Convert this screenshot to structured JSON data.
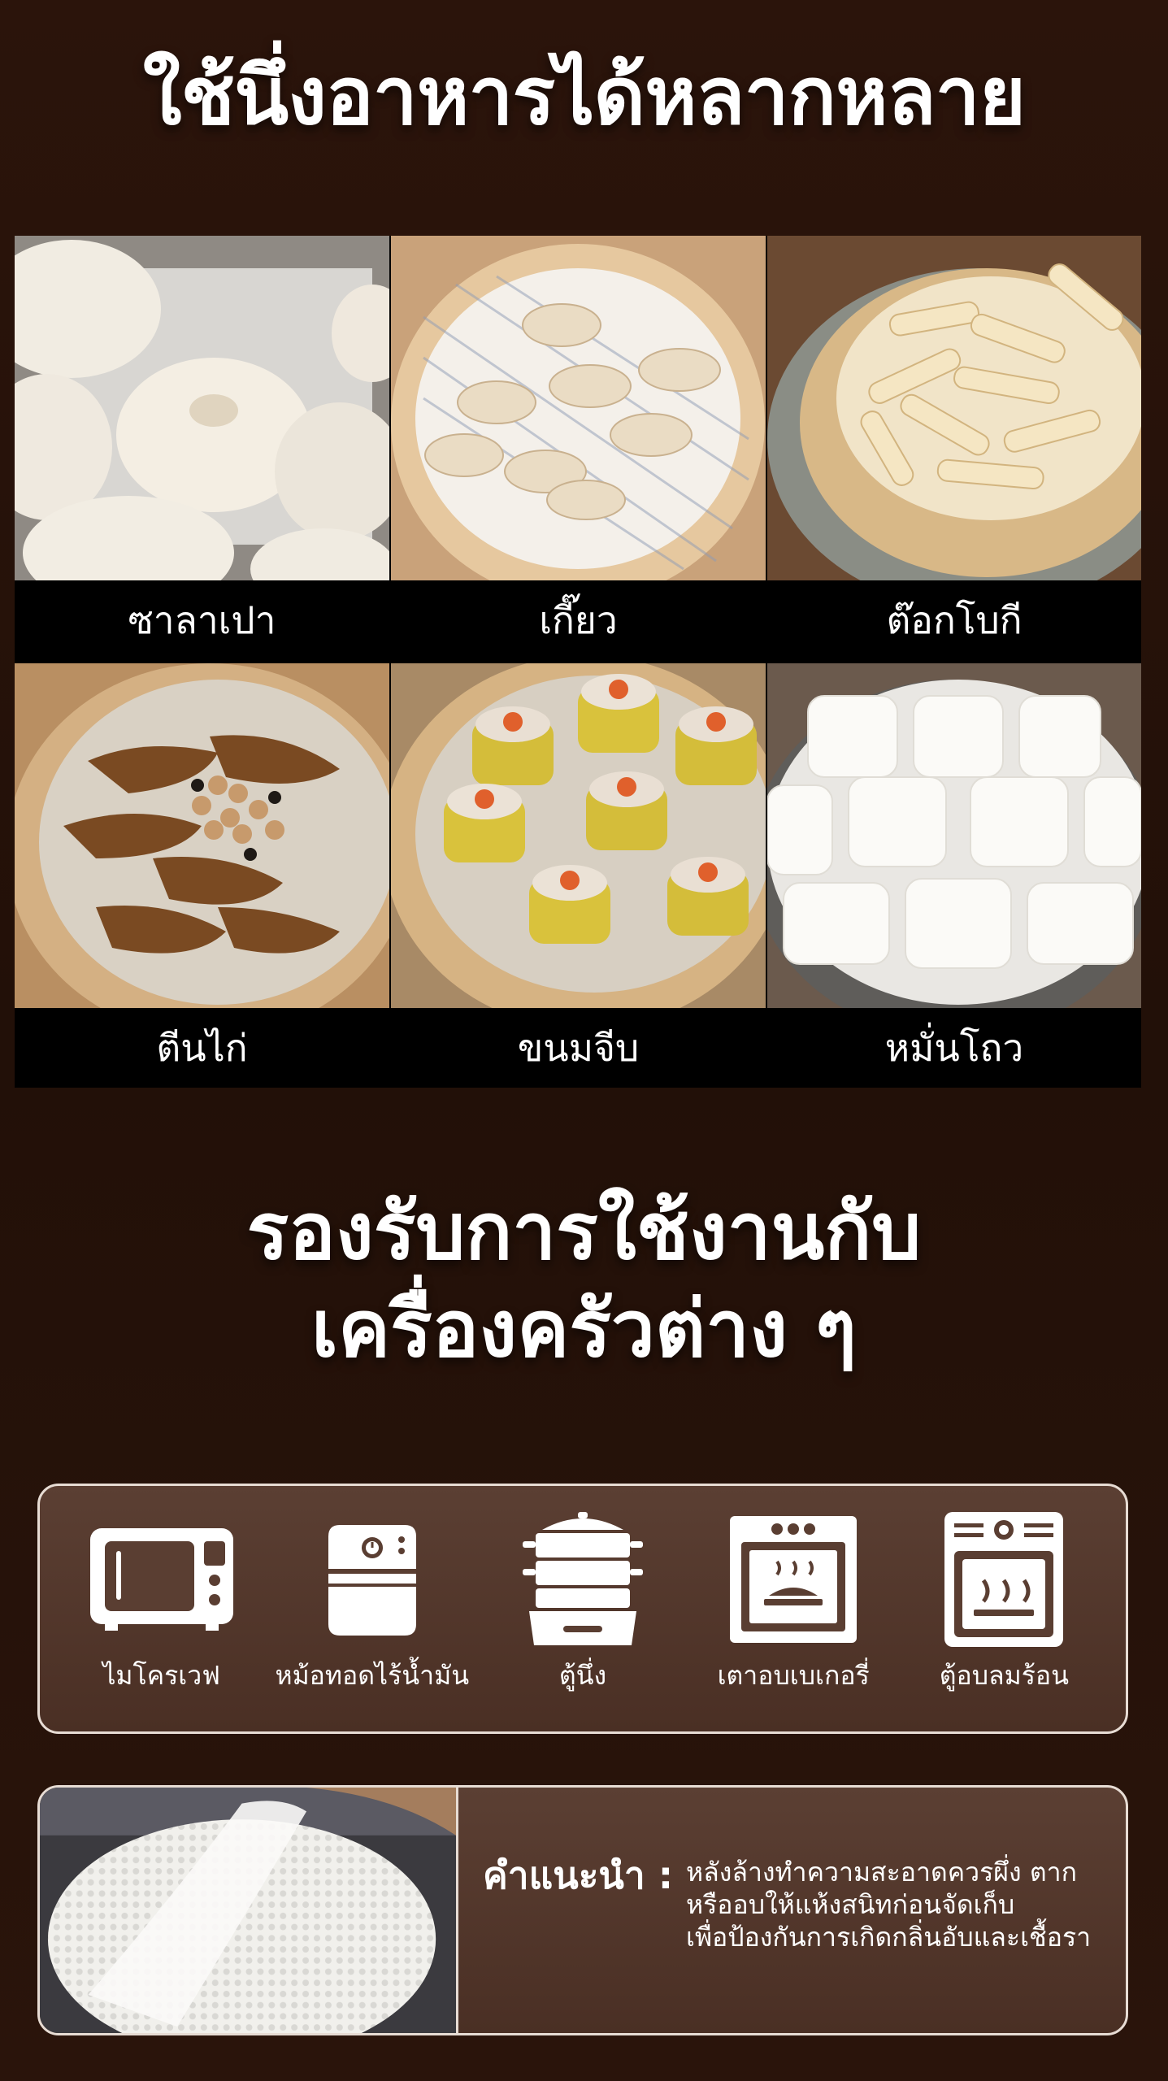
{
  "heading_top": "ใช้นึ่งอาหารได้หลากหลาย",
  "foods": [
    {
      "label": "ซาลาเปา",
      "icon": "steamed-bun-photo"
    },
    {
      "label": "เกี๊ยว",
      "icon": "dumpling-photo"
    },
    {
      "label": "ต๊อกโบกี",
      "icon": "tteokbokki-photo"
    },
    {
      "label": "ตีนไก่",
      "icon": "chicken-feet-photo"
    },
    {
      "label": "ขนมจีบ",
      "icon": "shumai-photo"
    },
    {
      "label": "หมั่นโถว",
      "icon": "mantou-photo"
    }
  ],
  "heading_middle": {
    "line1": "รองรับการใช้งานกับ",
    "line2": "เครื่องครัวต่าง ๆ"
  },
  "appliances": [
    {
      "label": "ไมโครเวฟ",
      "icon": "microwave-icon"
    },
    {
      "label": "หม้อทอดไร้น้ำมัน",
      "icon": "air-fryer-icon"
    },
    {
      "label": "ตู้นึ่ง",
      "icon": "steamer-icon"
    },
    {
      "label": "เตาอบเบเกอรี่",
      "icon": "bakery-oven-icon"
    },
    {
      "label": "ตู้อบลมร้อน",
      "icon": "convection-oven-icon"
    }
  ],
  "tip": {
    "heading": "คำแนะนำ :",
    "lines": [
      "หลังล้างทำความสะอาดควรผึ่ง ตาก",
      "หรืออบให้แห้งสนิทก่อนจัดเก็บ",
      "เพื่อป้องกันการเกิดกลิ่นอับและเชื้อรา"
    ]
  },
  "colors": {
    "background": "#2a130a",
    "panel": "#543a2e",
    "panel_border": "#e7dcd4",
    "text": "#ffffff"
  }
}
